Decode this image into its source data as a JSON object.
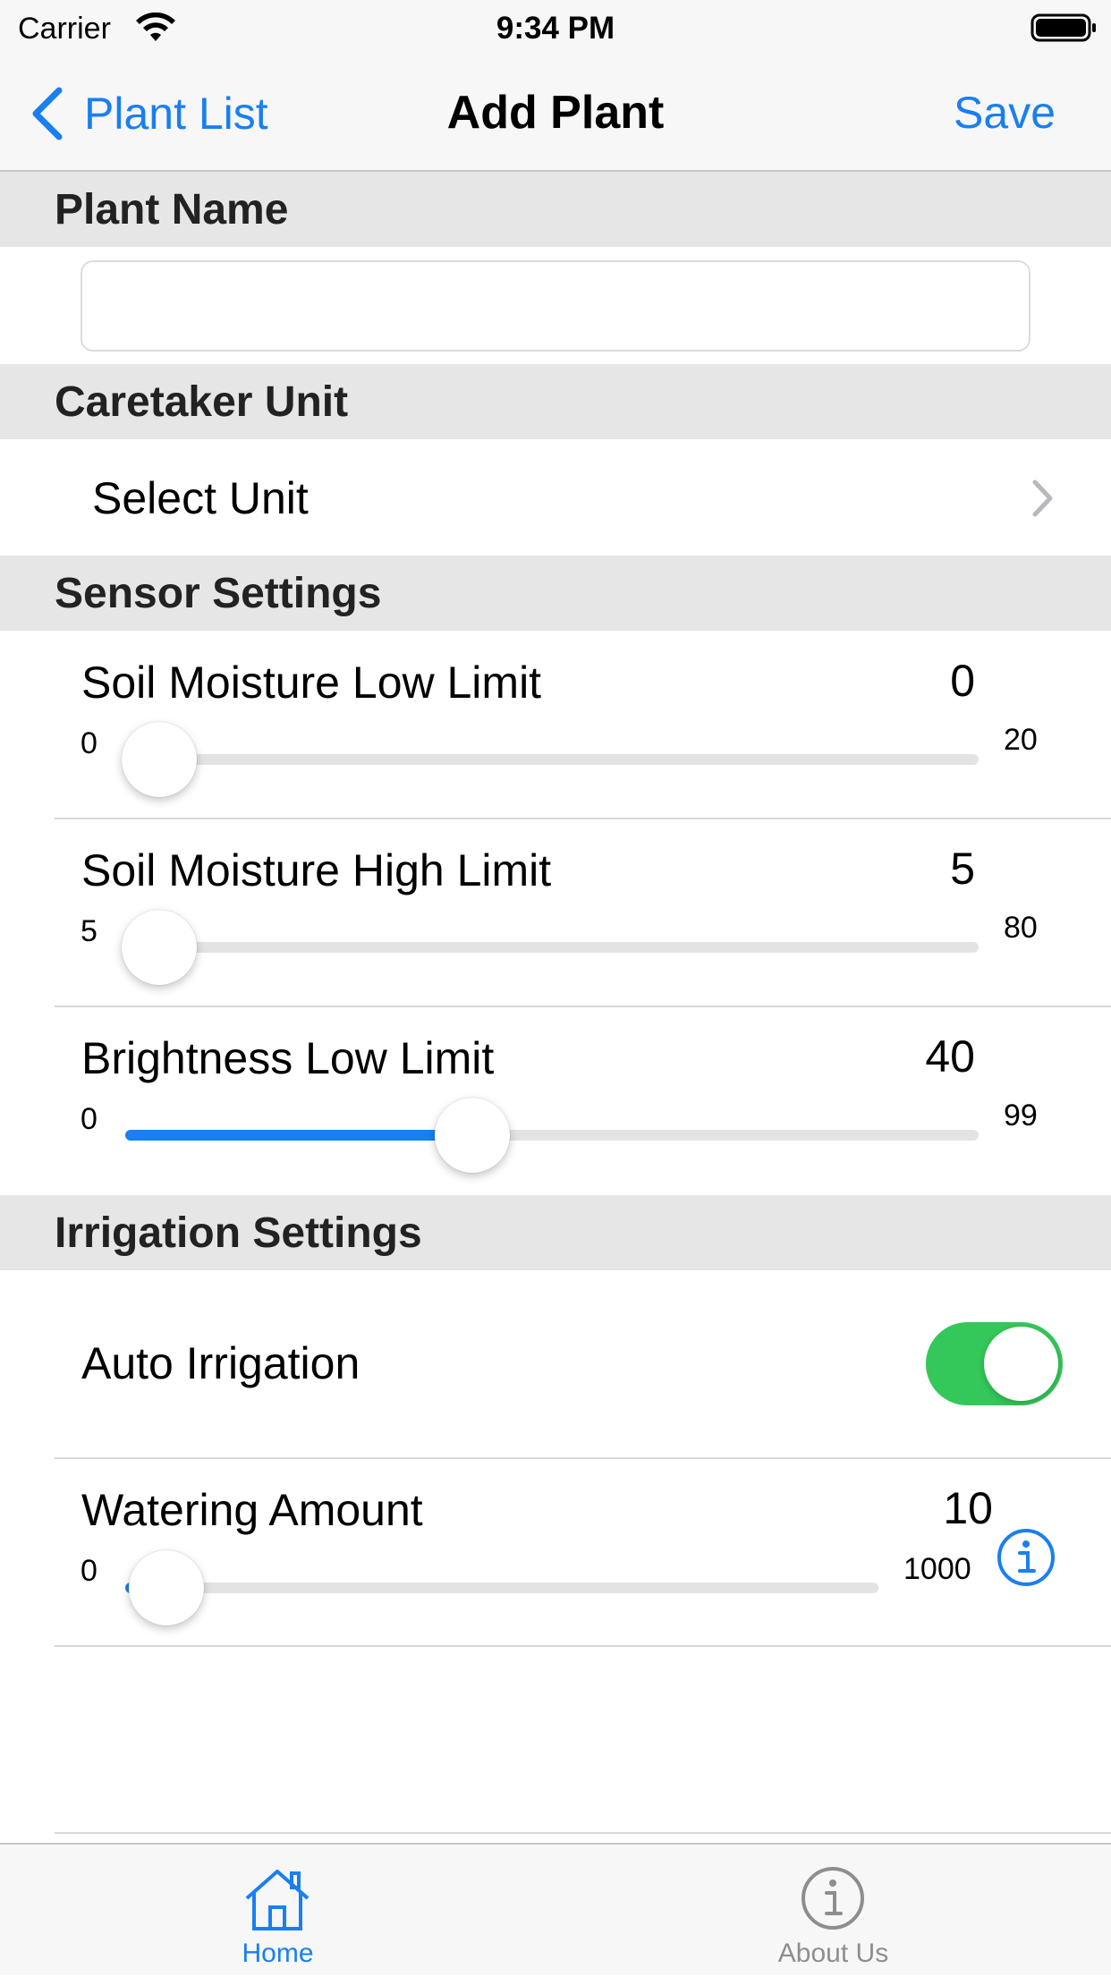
{
  "status_bar": {
    "carrier": "Carrier",
    "time": "9:34 PM",
    "icons": [
      "wifi-icon",
      "battery-icon"
    ]
  },
  "nav_bar": {
    "back_label": "Plant List",
    "title": "Add Plant",
    "save_label": "Save"
  },
  "sections": {
    "plant_name": "Plant Name",
    "caretaker_unit": "Caretaker Unit",
    "sensor_settings": "Sensor Settings",
    "irrigation_settings": "Irrigation Settings"
  },
  "plant_name_input": {
    "value": "",
    "placeholder": ""
  },
  "caretaker_unit": {
    "select_label": "Select Unit"
  },
  "sensor_settings": {
    "soil_low": {
      "label": "Soil Moisture Low Limit",
      "value": "0",
      "min": "0",
      "max": "20"
    },
    "soil_high": {
      "label": "Soil Moisture High Limit",
      "value": "5",
      "min": "5",
      "max": "80"
    },
    "brightness_low": {
      "label": "Brightness Low Limit",
      "value": "40",
      "min": "0",
      "max": "99"
    }
  },
  "irrigation_settings": {
    "auto_irrigation": {
      "label": "Auto Irrigation",
      "enabled": true
    },
    "watering_amount": {
      "label": "Watering Amount",
      "value": "10",
      "min": "0",
      "max": "1000"
    }
  },
  "tab_bar": {
    "tabs": [
      {
        "label": "Home",
        "icon": "house-icon",
        "selected": true
      },
      {
        "label": "About Us",
        "icon": "info-icon",
        "selected": false
      }
    ]
  },
  "colors": {
    "accent": "#1a7ff0",
    "toggle_on": "#34c759",
    "section_bg": "#e6e6e6",
    "tab_inactive": "#8e8e8e"
  }
}
